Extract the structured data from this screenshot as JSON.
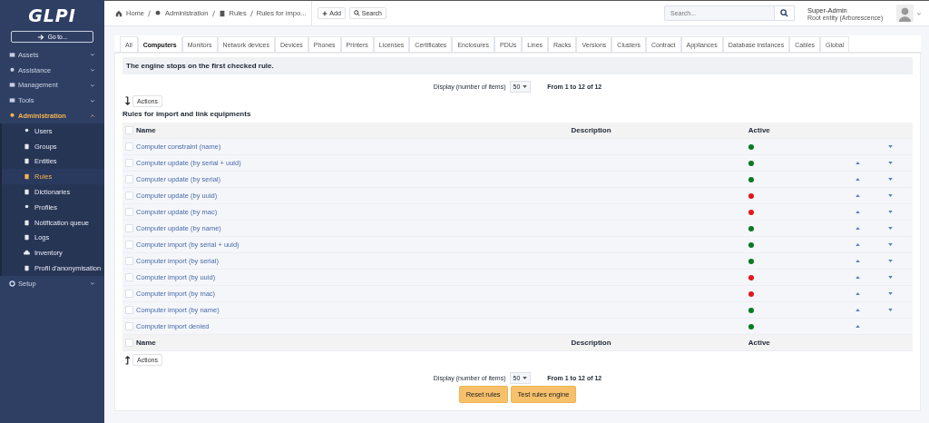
{
  "sidebar": {
    "logo": "GLPI",
    "goto_button": "Go to...",
    "items": [
      {
        "label": "Assets",
        "selected": false,
        "expanded": false
      },
      {
        "label": "Assistance",
        "selected": false,
        "expanded": false
      },
      {
        "label": "Management",
        "selected": false,
        "expanded": false
      },
      {
        "label": "Tools",
        "selected": false,
        "expanded": false
      },
      {
        "label": "Administration",
        "selected": true,
        "expanded": true,
        "children": [
          {
            "label": "Users",
            "selected": false
          },
          {
            "label": "Groups",
            "selected": false
          },
          {
            "label": "Entities",
            "selected": false
          },
          {
            "label": "Rules",
            "selected": true
          },
          {
            "label": "Dictionaries",
            "selected": false
          },
          {
            "label": "Profiles",
            "selected": false
          },
          {
            "label": "Notification queue",
            "selected": false
          },
          {
            "label": "Logs",
            "selected": false
          },
          {
            "label": "Inventory",
            "selected": false
          },
          {
            "label": "Profil d'anonymisation",
            "selected": false
          }
        ]
      },
      {
        "label": "Setup",
        "selected": false,
        "expanded": false
      }
    ]
  },
  "topbar": {
    "breadcrumbs": [
      "Home",
      "Administration",
      "Rules",
      "Rules for impo..."
    ],
    "add_button": "Add",
    "search_button": "Search",
    "search": {
      "placeholder": "Search..."
    },
    "user": {
      "name": "Super-Admin",
      "entity": "Root entity (Arborescence)"
    }
  },
  "tabs": [
    {
      "label": "All",
      "selected": false
    },
    {
      "label": "Computers",
      "selected": true
    },
    {
      "label": "Monitors",
      "selected": false
    },
    {
      "label": "Network devices",
      "selected": false
    },
    {
      "label": "Devices",
      "selected": false
    },
    {
      "label": "Phones",
      "selected": false
    },
    {
      "label": "Printers",
      "selected": false
    },
    {
      "label": "Licenses",
      "selected": false
    },
    {
      "label": "Certificates",
      "selected": false
    },
    {
      "label": "Enclosures",
      "selected": false
    },
    {
      "label": "PDUs",
      "selected": false
    },
    {
      "label": "Lines",
      "selected": false
    },
    {
      "label": "Racks",
      "selected": false
    },
    {
      "label": "Versions",
      "selected": false
    },
    {
      "label": "Clusters",
      "selected": false
    },
    {
      "label": "Contract",
      "selected": false
    },
    {
      "label": "Appliances",
      "selected": false
    },
    {
      "label": "Database instances",
      "selected": false
    },
    {
      "label": "Cables",
      "selected": false
    },
    {
      "label": "Global",
      "selected": false
    }
  ],
  "notice": "The engine stops on the first checked rule.",
  "pager_top": {
    "label": "Display (number of items)",
    "value": "50",
    "range": "From 1 to 12 of 12"
  },
  "actions_top": "Actions",
  "table": {
    "title": "Rules for import and link equipments",
    "select_all_checked": false,
    "columns": [
      "Name",
      "Description",
      "Active"
    ],
    "rows": [
      {
        "name": "Computer constraint (name)",
        "checked": false,
        "active": true,
        "up": false,
        "down": true
      },
      {
        "name": "Computer update (by serial + uuid)",
        "checked": false,
        "active": true,
        "up": true,
        "down": true
      },
      {
        "name": "Computer update (by serial)",
        "checked": false,
        "active": true,
        "up": true,
        "down": true
      },
      {
        "name": "Computer update (by uuid)",
        "checked": false,
        "active": false,
        "up": true,
        "down": true
      },
      {
        "name": "Computer update (by mac)",
        "checked": false,
        "active": false,
        "up": true,
        "down": true
      },
      {
        "name": "Computer update (by name)",
        "checked": false,
        "active": true,
        "up": true,
        "down": true
      },
      {
        "name": "Computer import (by serial + uuid)",
        "checked": false,
        "active": true,
        "up": true,
        "down": true
      },
      {
        "name": "Computer import (by serial)",
        "checked": false,
        "active": true,
        "up": true,
        "down": true
      },
      {
        "name": "Computer import (by uuid)",
        "checked": false,
        "active": false,
        "up": true,
        "down": true
      },
      {
        "name": "Computer import (by mac)",
        "checked": false,
        "active": false,
        "up": true,
        "down": true
      },
      {
        "name": "Computer import (by name)",
        "checked": false,
        "active": true,
        "up": true,
        "down": true
      },
      {
        "name": "Computer import denied",
        "checked": false,
        "active": true,
        "up": true,
        "down": false
      }
    ],
    "footer_select_all_checked": false,
    "footer_columns": [
      "Name",
      "Description",
      "Active"
    ]
  },
  "actions_bottom": "Actions",
  "pager_bottom": {
    "label": "Display (number of items)",
    "value": "50",
    "range": "From 1 to 12 of 12"
  },
  "buttons": [
    "Reset rules",
    "Test rules engine"
  ]
}
